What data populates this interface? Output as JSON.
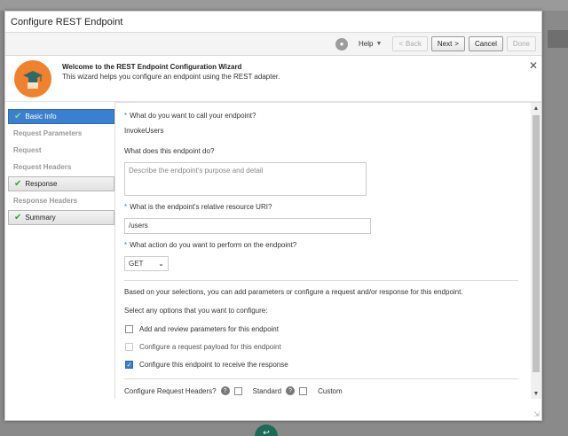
{
  "dialog": {
    "title": "Configure REST Endpoint"
  },
  "toolbar": {
    "help_label": "Help",
    "back_label": "Back",
    "next_label": "Next",
    "cancel_label": "Cancel",
    "done_label": "Done"
  },
  "banner": {
    "heading": "Welcome to the REST Endpoint Configuration Wizard",
    "subtext": "This wizard helps you configure an endpoint using the REST adapter."
  },
  "nav": {
    "items": [
      {
        "label": "Basic Info",
        "state": "active"
      },
      {
        "label": "Request Parameters",
        "state": "disabled"
      },
      {
        "label": "Request",
        "state": "disabled"
      },
      {
        "label": "Request Headers",
        "state": "disabled"
      },
      {
        "label": "Response",
        "state": "done"
      },
      {
        "label": "Response Headers",
        "state": "disabled"
      },
      {
        "label": "Summary",
        "state": "done"
      }
    ]
  },
  "form": {
    "name_question": "What do you want to call your endpoint?",
    "name_value": "InvokeUsers",
    "desc_question": "What does this endpoint do?",
    "desc_placeholder": "Describe the endpoint's purpose and detail",
    "uri_question": "What is the endpoint's relative resource URI?",
    "uri_value": "/users",
    "action_question": "What action do you want to perform on the endpoint?",
    "action_value": "GET",
    "info_text": "Based on your selections, you can add parameters or configure a request and/or response for this endpoint.",
    "select_text": "Select any options that you want to configure:",
    "options": [
      {
        "label": "Add and review parameters for this endpoint",
        "checked": false,
        "disabled": false
      },
      {
        "label": "Configure a request payload for this endpoint",
        "checked": false,
        "disabled": true
      },
      {
        "label": "Configure this endpoint to receive the response",
        "checked": true,
        "disabled": false
      }
    ],
    "headers_label": "Configure Request Headers?",
    "headers_standard": "Standard",
    "headers_custom": "Custom"
  }
}
